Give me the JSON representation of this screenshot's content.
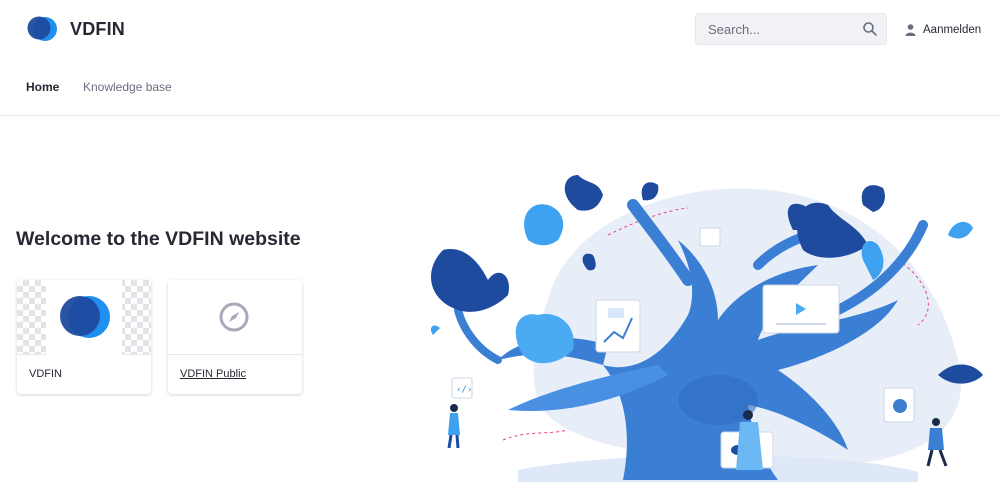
{
  "header": {
    "brand": "VDFIN",
    "search_placeholder": "Search...",
    "signin_label": "Aanmelden"
  },
  "nav": {
    "items": [
      {
        "label": "Home",
        "active": true
      },
      {
        "label": "Knowledge base",
        "active": false
      }
    ]
  },
  "main": {
    "heading": "Welcome to the VDFIN website",
    "cards": [
      {
        "title": "VDFIN"
      },
      {
        "title": "VDFIN Public"
      }
    ]
  },
  "colors": {
    "brand_dark": "#1e4b9e",
    "brand_light": "#1f8ff0",
    "tree_blue": "#3b7fd4",
    "text": "#272833"
  },
  "icons": [
    "search-icon",
    "user-icon",
    "compass-icon"
  ]
}
